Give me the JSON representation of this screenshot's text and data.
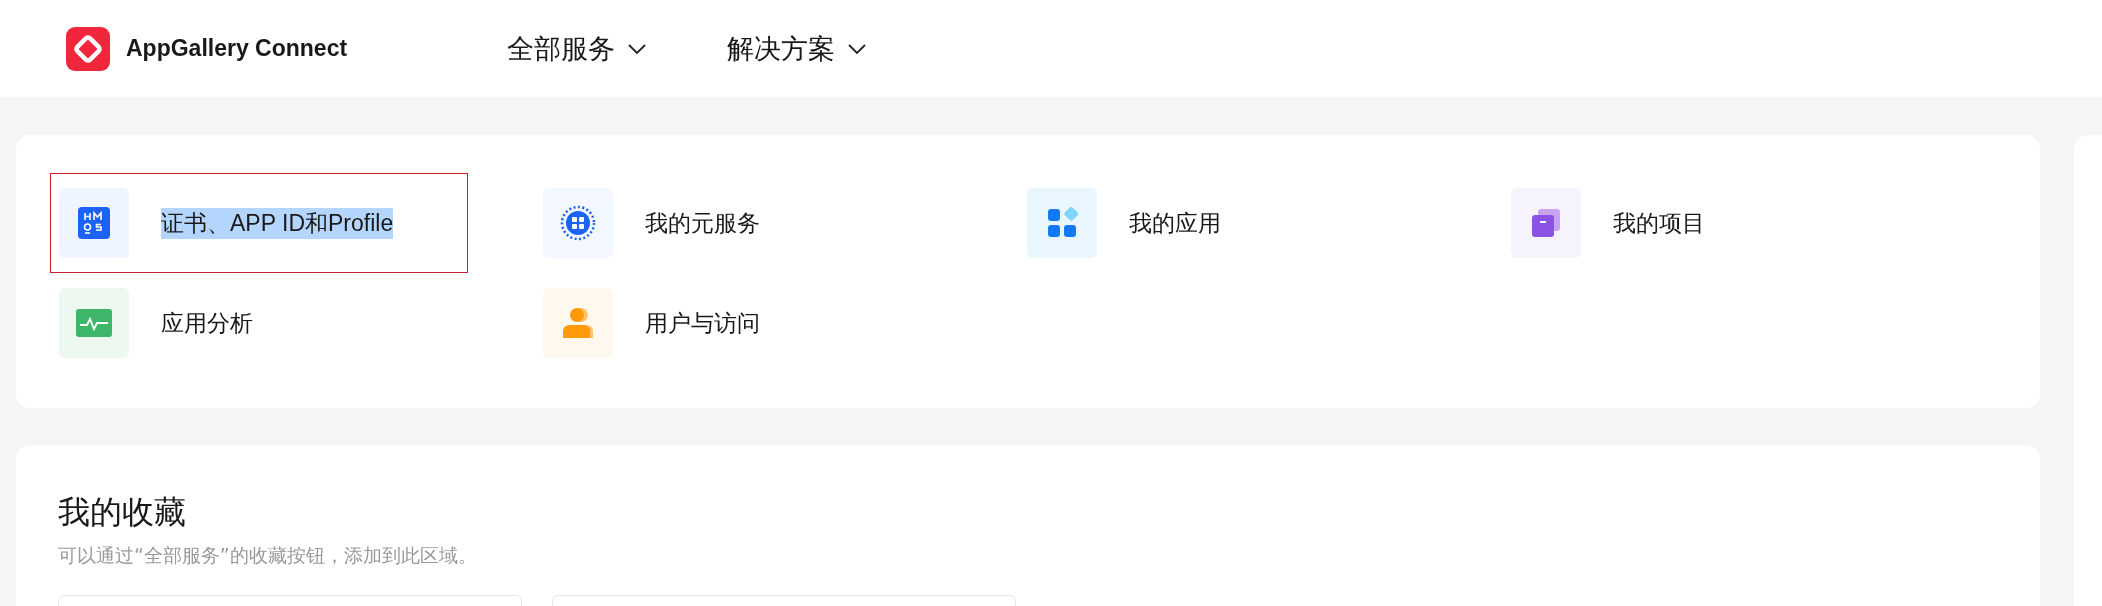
{
  "header": {
    "brand": "AppGallery Connect",
    "nav": [
      {
        "label": "全部服务",
        "expanded": false
      },
      {
        "label": "解决方案",
        "expanded": false
      }
    ]
  },
  "services": [
    {
      "kind": "hmos",
      "label": "证书、APP ID和Profile",
      "highlighted": true,
      "color": "#eef5ff"
    },
    {
      "kind": "atomic",
      "label": "我的元服务",
      "highlighted": false,
      "color": "#f3f7ff"
    },
    {
      "kind": "apps",
      "label": "我的应用",
      "highlighted": false,
      "color": "#eaf6fe"
    },
    {
      "kind": "project",
      "label": "我的项目",
      "highlighted": false,
      "color": "#f7f3fd"
    },
    {
      "kind": "analytics",
      "label": "应用分析",
      "highlighted": false,
      "color": "#edf8f0"
    },
    {
      "kind": "user",
      "label": "用户与访问",
      "highlighted": false,
      "color": "#fff8ee"
    }
  ],
  "favorites": {
    "title": "我的收藏",
    "hint": "可以通过“全部服务”的收藏按钮，添加到此区域。"
  }
}
